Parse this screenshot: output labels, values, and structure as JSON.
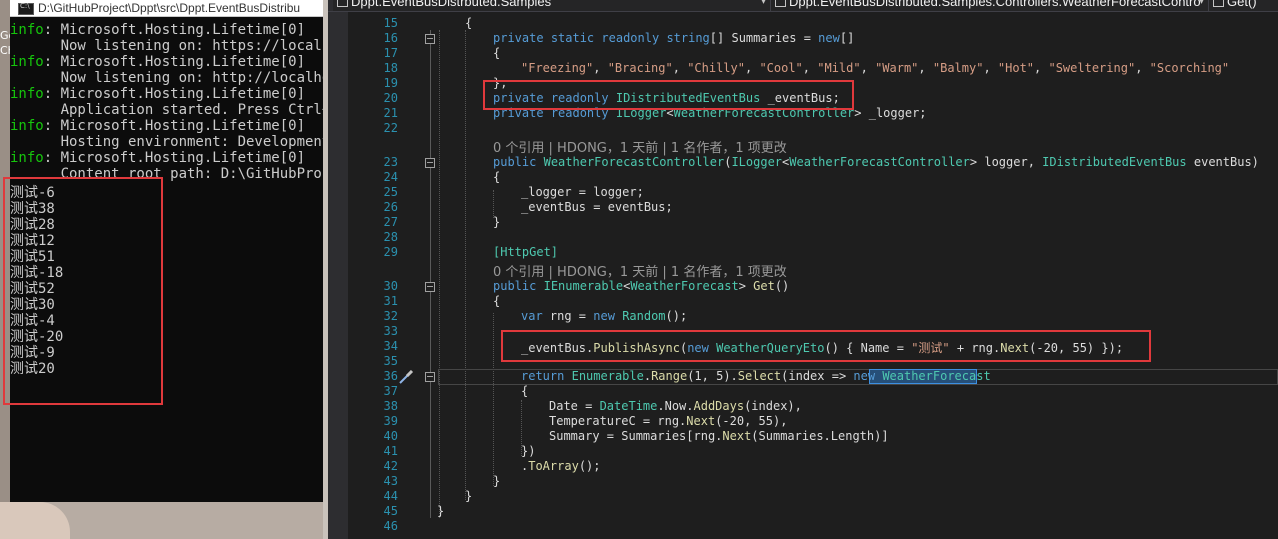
{
  "desktop": {
    "fragments": [
      "Go",
      "Chi"
    ]
  },
  "console": {
    "title": "D:\\GitHubProject\\Dppt\\src\\Dppt.EventBusDistribu",
    "icon_label": "C:\\",
    "log": [
      {
        "level": "info",
        "text": ": Microsoft.Hosting.Lifetime[0]"
      },
      {
        "level": "",
        "text": "      Now listening on: https://localho"
      },
      {
        "level": "info",
        "text": ": Microsoft.Hosting.Lifetime[0]"
      },
      {
        "level": "",
        "text": "      Now listening on: http://localhos"
      },
      {
        "level": "info",
        "text": ": Microsoft.Hosting.Lifetime[0]"
      },
      {
        "level": "",
        "text": "      Application started. Press Ctrl+C"
      },
      {
        "level": "info",
        "text": ": Microsoft.Hosting.Lifetime[0]"
      },
      {
        "level": "",
        "text": "      Hosting environment: Development"
      },
      {
        "level": "info",
        "text": ": Microsoft.Hosting.Lifetime[0]"
      },
      {
        "level": "",
        "text": "      Content root path: D:\\GitHubProje"
      }
    ],
    "output": [
      "测试-6",
      "测试38",
      "测试28",
      "测试12",
      "测试51",
      "测试-18",
      "测试52",
      "测试30",
      "测试-4",
      "测试-20",
      "测试-9",
      "测试20"
    ]
  },
  "editor": {
    "nav": {
      "project": "Dppt.EventBusDistrbuted.Samples",
      "class": "Dppt.EventBusDistributed.Samples.Controllers.WeatherForecastContro",
      "member": "Get()"
    },
    "codelens": [
      "0 个引用 | HDONG，1 天前 | 1 名作者，1 项更改",
      "0 个引用 | HDONG，1 天前 | 1 名作者，1 项更改"
    ],
    "line_numbers": [
      "15",
      "16",
      "17",
      "18",
      "19",
      "20",
      "21",
      "22",
      "23",
      "24",
      "25",
      "26",
      "27",
      "28",
      "29",
      "30",
      "31",
      "32",
      "33",
      "34",
      "35",
      "36",
      "37",
      "38",
      "39",
      "40",
      "41",
      "42",
      "43",
      "44",
      "45",
      "46"
    ],
    "code": {
      "l15": "{",
      "l16": [
        "private",
        " ",
        "static",
        " ",
        "readonly",
        " ",
        "string",
        "[] Summaries = ",
        "new",
        "[]"
      ],
      "l17": "{",
      "l18": [
        "\"Freezing\"",
        ", ",
        "\"Bracing\"",
        ", ",
        "\"Chilly\"",
        ", ",
        "\"Cool\"",
        ", ",
        "\"Mild\"",
        ", ",
        "\"Warm\"",
        ", ",
        "\"Balmy\"",
        ", ",
        "\"Hot\"",
        ", ",
        "\"Sweltering\"",
        ", ",
        "\"Scorching\""
      ],
      "l19": "};",
      "l20": [
        "private",
        " ",
        "readonly",
        " ",
        "IDistributedEventBus",
        " _eventBus;"
      ],
      "l21": [
        "private",
        " ",
        "readonly",
        " ",
        "ILogger",
        "<",
        "WeatherForecastController",
        "> _logger;"
      ],
      "l23": [
        "public",
        " ",
        "WeatherForecastController",
        "(",
        "ILogger",
        "<",
        "WeatherForecastController",
        "> logger, ",
        "IDistributedEventBus",
        " eventBus)"
      ],
      "l24": "{",
      "l25": "_logger = logger;",
      "l26": "_eventBus = eventBus;",
      "l27": "}",
      "l29": "[HttpGet]",
      "l30": [
        "public",
        " ",
        "IEnumerable",
        "<",
        "WeatherForecast",
        "> ",
        "Get",
        "()"
      ],
      "l31": "{",
      "l32": [
        "var",
        " rng = ",
        "new",
        " ",
        "Random",
        "();"
      ],
      "l34": [
        "_eventBus.",
        "PublishAsync",
        "(",
        "new",
        " ",
        "WeatherQueryEto",
        "() { Name = ",
        "\"测试\"",
        " + rng.",
        "Next",
        "(-20, 55) });"
      ],
      "l36": [
        "return",
        " ",
        "Enumerable",
        ".",
        "Range",
        "(1, 5).",
        "Select",
        "(index => ",
        "new",
        " ",
        "WeatherForecast"
      ],
      "l37": "{",
      "l38": [
        "Date = ",
        "DateTime",
        ".Now.",
        "AddDays",
        "(index),"
      ],
      "l39": [
        "TemperatureC = rng.",
        "Next",
        "(-20, 55),"
      ],
      "l40": [
        "Summary = Summaries[rng.",
        "Next",
        "(Summaries.Length)]"
      ],
      "l41": "})",
      "l42": [
        ".",
        "ToArray",
        "();"
      ],
      "l43": "}",
      "l44": "}",
      "l45": "}"
    }
  }
}
